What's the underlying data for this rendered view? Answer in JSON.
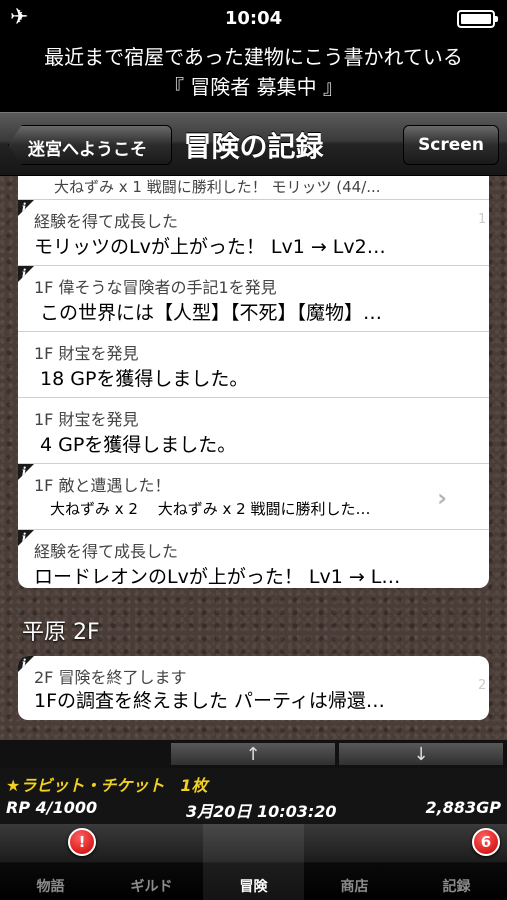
{
  "status_bar": {
    "time": "10:04",
    "airplane_icon": "airplane-icon",
    "battery_level": 1.0
  },
  "message": {
    "line1": "最近まで宿屋であった建物にこう書かれている",
    "line2": "『 冒険者 募集中 』"
  },
  "nav": {
    "back_label": "迷宮へようこそ",
    "title": "冒険の記録",
    "screen_label": "Screen"
  },
  "log": {
    "cut_text": "大ねずみ x 1  戦闘に勝利した！ モリッツ (44/...",
    "entries": [
      {
        "sub": "経験を得て成長した",
        "main": "モリッツのLvが上がった！ Lv1 → Lv2…",
        "info": "i"
      },
      {
        "sub": "1F 偉そうな冒険者の手記1を発見",
        "main": "この世界には【人型】【不死】【魔物】…",
        "info": "i"
      },
      {
        "sub": "1F 財宝を発見",
        "main": "18 GPを獲得しました。"
      },
      {
        "sub": "1F 財宝を発見",
        "main": "4 GPを獲得しました。"
      },
      {
        "sub": "1F 敵と遭遇した！",
        "main": "大ねずみ x 2　 大ねずみ x 2  戦闘に勝利した…",
        "info": "i",
        "chevron": "›"
      },
      {
        "sub": "経験を得て成長した",
        "main": "ロードレオンのLvが上がった！ Lv1 → L…",
        "info": "i"
      }
    ],
    "side_num_1": "1",
    "section2_header": "平原 2F",
    "section2_entry": {
      "sub": "2F 冒険を終了します",
      "main": "1Fの調査を終えました パーティは帰還…",
      "info": "i"
    },
    "side_num_2": "2"
  },
  "scroll": {
    "up": "↑",
    "down": "↓"
  },
  "info": {
    "ticket": "★ラビット・チケット　1枚",
    "rp": "RP 4/1000",
    "datetime": "3月20日  10:03:20",
    "gp": "2,883GP"
  },
  "tabs": [
    {
      "label": "物語",
      "badge": "!"
    },
    {
      "label": "ギルド"
    },
    {
      "label": "冒険",
      "active": true
    },
    {
      "label": "商店"
    },
    {
      "label": "記録",
      "badge": "6"
    }
  ],
  "colors": {
    "ticket": "#f0d020",
    "badge": "#c80000",
    "content_bg": "#4a3c36"
  }
}
